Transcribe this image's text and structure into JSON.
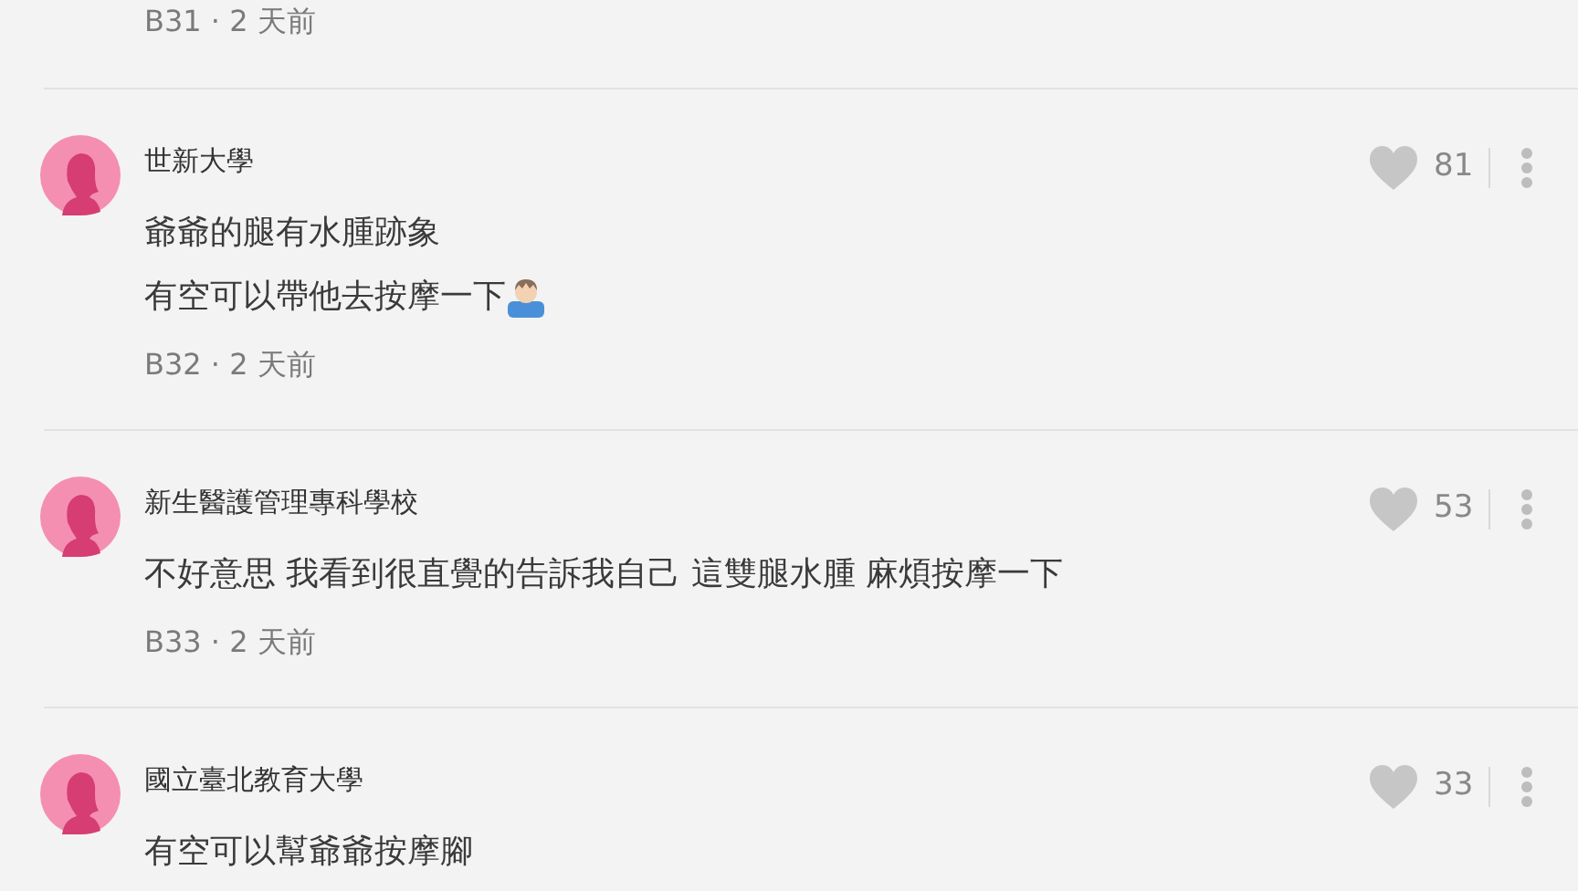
{
  "previous_comment": {
    "meta": "B31 · 2 天前"
  },
  "comments": [
    {
      "author": "世新大學",
      "lines": [
        {
          "kind": "text",
          "text": "爺爺的腿有水腫跡象"
        },
        {
          "kind": "text-with-icon",
          "text": "有空可以帶他去按摩一下"
        }
      ],
      "meta": "B32 · 2 天前",
      "likes": "81",
      "liked": false
    },
    {
      "author": "新生醫護管理專科學校",
      "lines": [
        {
          "kind": "text",
          "text": "不好意思 我看到很直覺的告訴我自己 這雙腿水腫 麻煩按摩一下"
        }
      ],
      "meta": "B33 · 2 天前",
      "likes": "53",
      "liked": false
    },
    {
      "author": "國立臺北教育大學",
      "lines": [
        {
          "kind": "text",
          "text": "有空可以幫爺爺按摩腳"
        }
      ],
      "likes": "33",
      "liked": false
    }
  ]
}
